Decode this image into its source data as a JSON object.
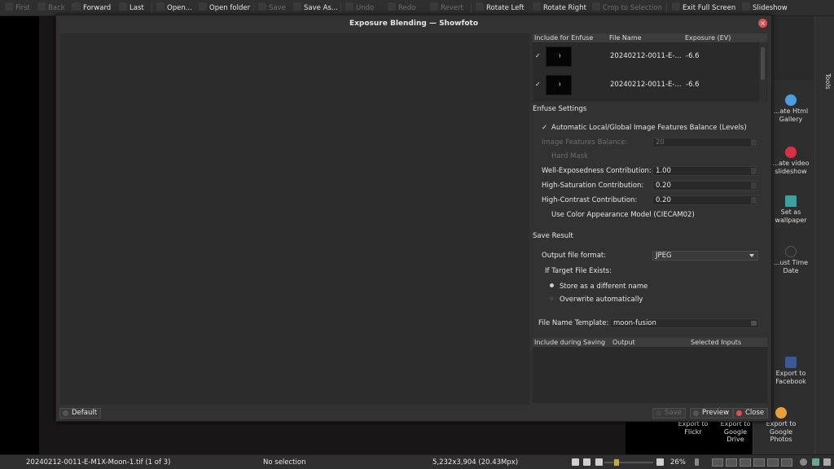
{
  "toolbar": {
    "items": [
      {
        "label": "First",
        "enabled": false
      },
      {
        "label": "Back",
        "enabled": false
      },
      {
        "label": "Forward",
        "enabled": true
      },
      {
        "label": "Last",
        "enabled": true
      },
      {
        "label": "Open...",
        "enabled": true
      },
      {
        "label": "Open folder",
        "enabled": true
      },
      {
        "label": "Save",
        "enabled": false
      },
      {
        "label": "Save As...",
        "enabled": true
      },
      {
        "label": "Undo",
        "enabled": false
      },
      {
        "label": "Redo",
        "enabled": false
      },
      {
        "label": "Revert",
        "enabled": false
      },
      {
        "label": "Rotate Left",
        "enabled": true
      },
      {
        "label": "Rotate Right",
        "enabled": true
      },
      {
        "label": "Crop to Selection",
        "enabled": false
      },
      {
        "label": "Exit Full Screen",
        "enabled": true
      },
      {
        "label": "Slideshow",
        "enabled": true
      }
    ]
  },
  "dialog": {
    "title": "Exposure Blending — Showfoto",
    "input_table": {
      "columns": [
        "Include for Enfuse",
        "File Name",
        "Exposure (EV)"
      ],
      "rows": [
        {
          "checked": "✓",
          "file": "20240212-0011-E-...",
          "ev": "-6.6"
        },
        {
          "checked": "✓",
          "file": "20240212-0011-E-...",
          "ev": "-6.6"
        }
      ]
    },
    "enfuse": {
      "section_title": "Enfuse Settings",
      "auto_balance_label": "Automatic Local/Global Image Features Balance (Levels)",
      "features_balance_label": "Image Features Balance:",
      "features_balance_value": "20",
      "hard_mask_label": "Hard Mask",
      "well_exposed_label": "Well-Exposedness Contribution:",
      "well_exposed_value": "1.00",
      "high_sat_label": "High-Saturation Contribution:",
      "high_sat_value": "0.20",
      "high_contrast_label": "High-Contrast Contribution:",
      "high_contrast_value": "0.20",
      "ciecam_label": "Use Color Appearance Model (CIECAM02)"
    },
    "save": {
      "section_title": "Save Result",
      "format_label": "Output file format:",
      "format_value": "JPEG",
      "exists_label": "If Target File Exists:",
      "store_label": "Store as a different name",
      "overwrite_label": "Overwrite automatically",
      "template_label": "File Name Template:",
      "template_value": "moon-fusion"
    },
    "output_table": {
      "columns": [
        "Include during Saving",
        "Output",
        "Selected Inputs"
      ]
    },
    "buttons": {
      "default": "Default",
      "save": "Save",
      "preview": "Preview",
      "close": "Close"
    }
  },
  "tools": {
    "tab_label": "Tools",
    "items": [
      {
        "label": "...ate Html\nGallery",
        "color": "#4a9de0"
      },
      {
        "label": "...ate video\nslideshow",
        "color": "#d9304a"
      },
      {
        "label": "Set as\nwallpaper",
        "color": "#3aa0a0"
      },
      {
        "label": "...ust Time\nDate",
        "color": "#555555"
      },
      {
        "label": "Export to\nFacebook",
        "color": "#3b5998"
      },
      {
        "label": "Export to\nFlickr",
        "color": "#888888"
      },
      {
        "label": "Export to\nGoogle\nDrive",
        "color": "#888888"
      },
      {
        "label": "Export to\nGoogle\nPhotos",
        "color": "#e8a13a"
      }
    ]
  },
  "status": {
    "file": "20240212-0011-E-M1X-Moon-1.tif (1 of 3)",
    "selection": "No selection",
    "dimensions": "5,232x3,904 (20.43Mpx)",
    "zoom": "26%"
  },
  "colors": {
    "accent": "#e0504f",
    "zoom_handle": "#c6a84a"
  }
}
